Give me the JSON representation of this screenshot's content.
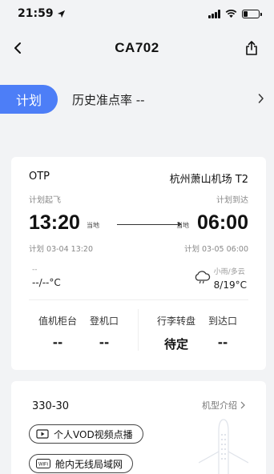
{
  "status": {
    "time": "21:59"
  },
  "nav": {
    "title": "CA702"
  },
  "plan": {
    "pill": "计划",
    "otp_history": "历史准点率 --"
  },
  "flight": {
    "otp_label": "OTP",
    "arrival_airport": "杭州萧山机场 T2",
    "planned_departure_label": "计划起飞",
    "planned_arrival_label": "计划到达",
    "departure_time": "13:20",
    "departure_tag": "当地",
    "arrival_tag": "当地",
    "arrival_time": "06:00",
    "planned_departure_detail": "计划 03-04 13:20",
    "planned_arrival_detail": "计划 03-05 06:00",
    "dep_weather_small": "--",
    "dep_weather_temp": "--/--°C",
    "arr_weather_small": "小雨/多云",
    "arr_weather_temp": "8/19°C",
    "facilities": [
      {
        "label": "值机柜台",
        "value": "--"
      },
      {
        "label": "登机口",
        "value": "--"
      },
      {
        "label": "行李转盘",
        "value": "待定"
      },
      {
        "label": "到达口",
        "value": "--"
      }
    ]
  },
  "aircraft": {
    "model": "330-30",
    "intro": "机型介绍",
    "services": [
      {
        "label": "个人VOD视频点播",
        "icon": "video-icon"
      },
      {
        "label": "舱内无线局域网",
        "icon": "wifi-icon",
        "badge": "WiFi"
      }
    ]
  }
}
